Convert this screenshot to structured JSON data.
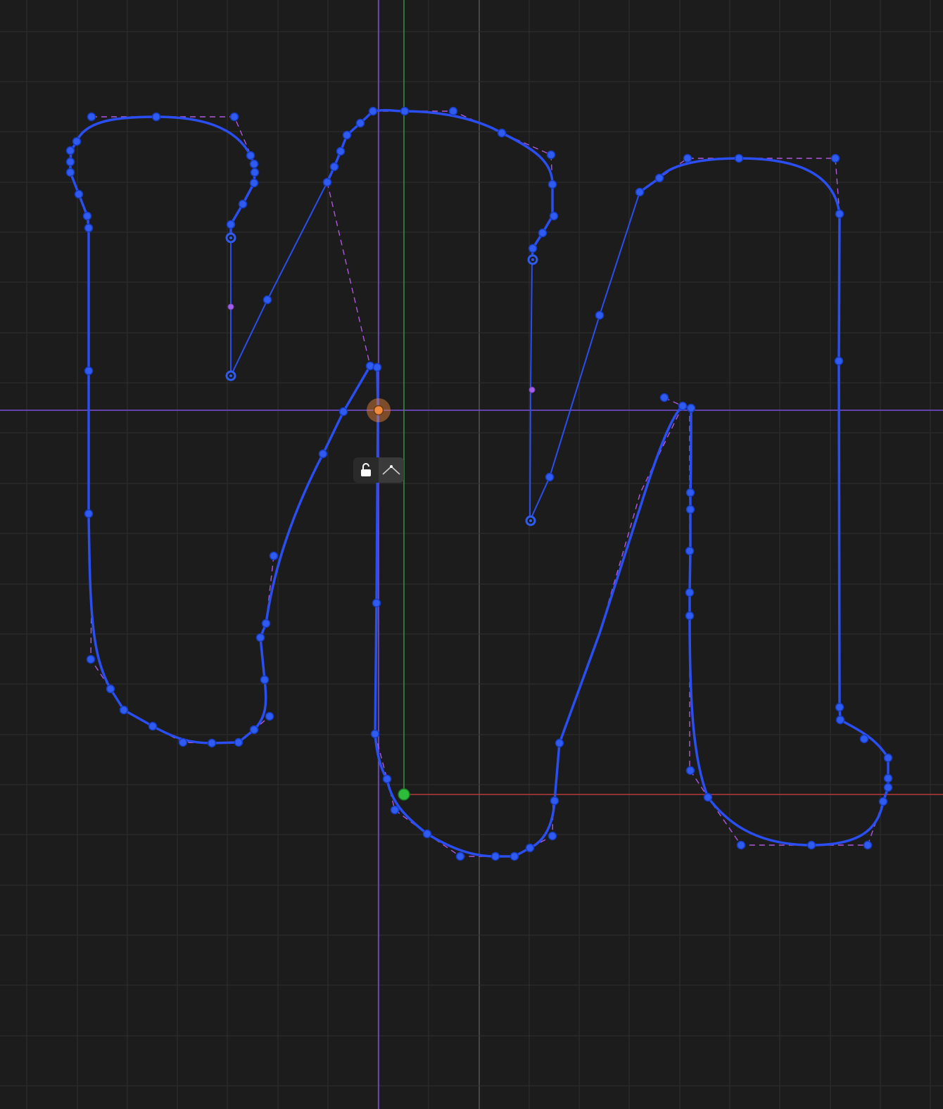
{
  "editor": {
    "colors": {
      "background": "#1c1c1c",
      "grid_minor": "#2f2f2f",
      "grid_major": "#3a3a3a",
      "path": "#2a4ef0",
      "point": "#2f5bf0",
      "handle_line": "#b056e0",
      "guide_vertical": "#7b4fd8",
      "guide_horizontal": "#7b4fd8",
      "axis_y": "#3c8f49",
      "axis_x": "#b33a3a",
      "origin": "#2ebd3a",
      "selected_point": "#f08a3c"
    },
    "toolbar": {
      "lock_icon": "unlock-icon",
      "smooth_icon": "corner-point-icon"
    }
  }
}
